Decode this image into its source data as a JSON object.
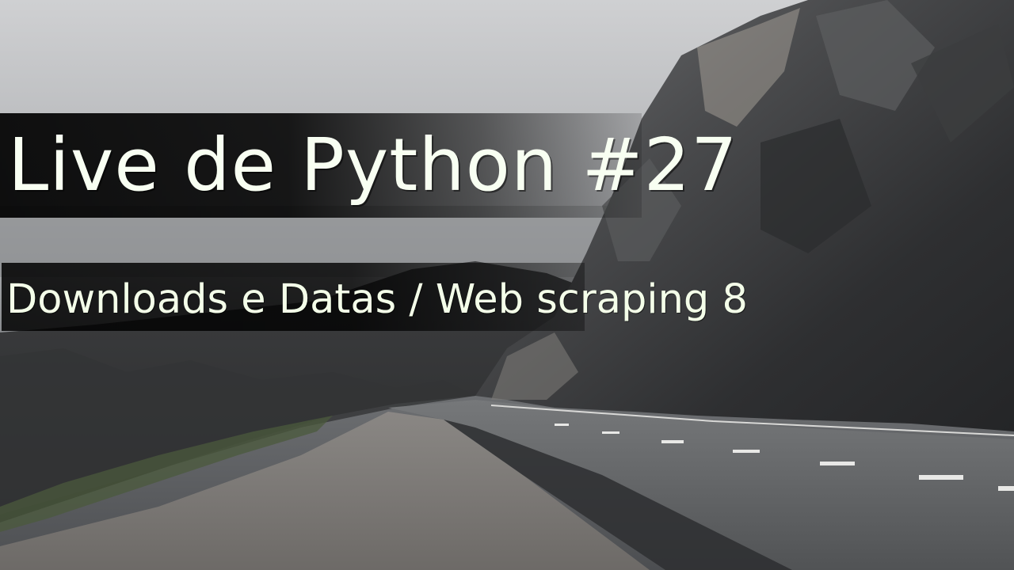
{
  "title": "Live de Python #27",
  "subtitle": "Downloads e Datas / Web scraping 8",
  "colors": {
    "text": "#f8fff2",
    "band": "#000000",
    "sky": "#c9cacd",
    "rock": "#3a3b3d",
    "road": "#5f6163"
  }
}
